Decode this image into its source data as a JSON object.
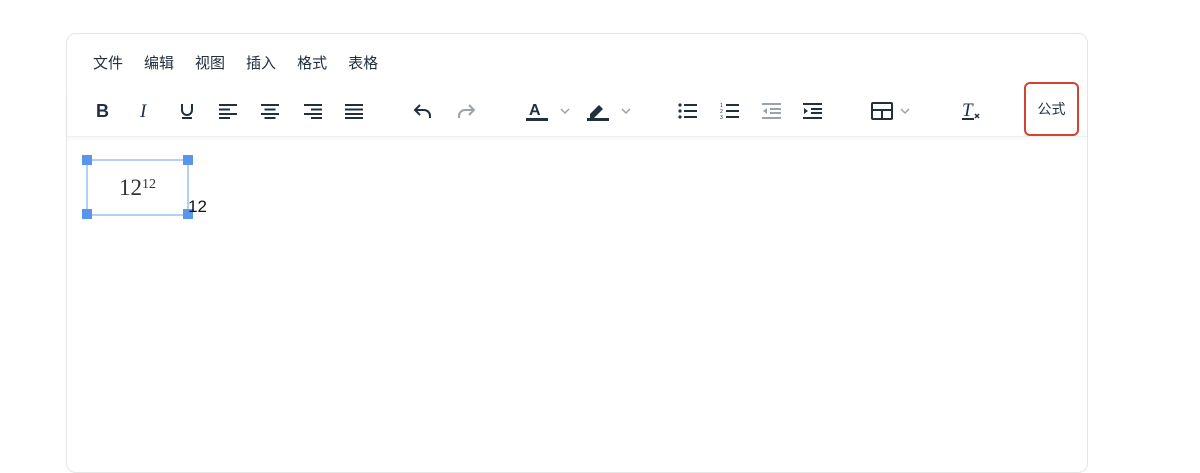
{
  "menubar": {
    "items": [
      "文件",
      "编辑",
      "视图",
      "插入",
      "格式",
      "表格"
    ]
  },
  "toolbar": {
    "buttons": [
      "bold-icon",
      "italic-icon",
      "underline-icon",
      "align-left-icon",
      "align-center-icon",
      "align-right-icon",
      "align-justify-icon",
      "undo-icon",
      "redo-icon",
      "text-color-icon",
      "highlight-color-icon",
      "bullet-list-icon",
      "numbered-list-icon",
      "outdent-icon",
      "indent-icon",
      "table-icon",
      "clear-format-icon"
    ],
    "formula_label": "公式",
    "accent_color": "#d0452f"
  },
  "content": {
    "formula_base": "12",
    "formula_exponent": "12",
    "trailing_text": "12",
    "selection_color": "#5a95ec"
  }
}
